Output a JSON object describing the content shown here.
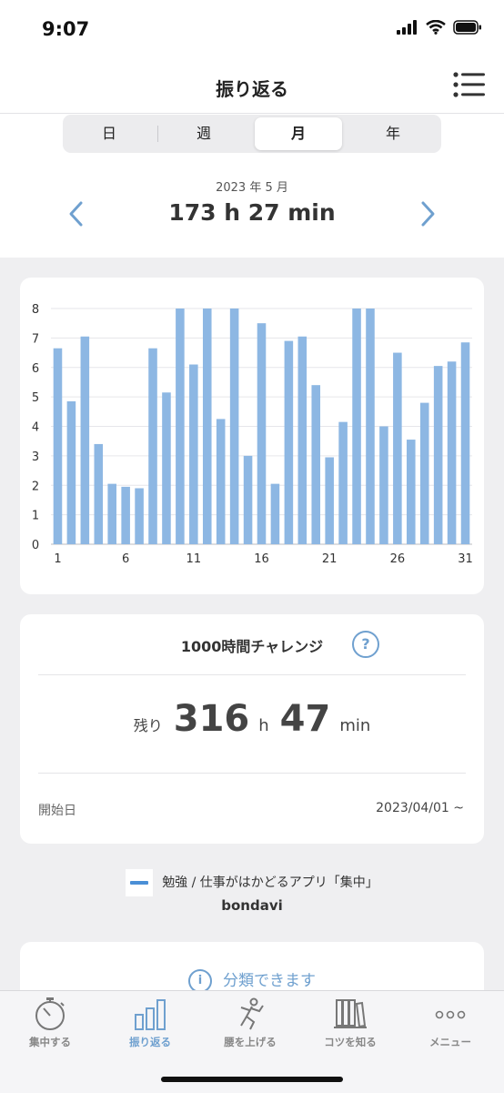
{
  "status_bar": {
    "time": "9:07"
  },
  "header": {
    "title": "振り返る"
  },
  "segments": [
    "日",
    "週",
    "月",
    "年"
  ],
  "active_segment": "月",
  "period": {
    "label": "2023 年 5 月",
    "total": "173 h 27 min"
  },
  "chart_data": {
    "type": "bar",
    "x": [
      1,
      2,
      3,
      4,
      5,
      6,
      7,
      8,
      9,
      10,
      11,
      12,
      13,
      14,
      15,
      16,
      17,
      18,
      19,
      20,
      21,
      22,
      23,
      24,
      25,
      26,
      27,
      28,
      29,
      30,
      31
    ],
    "values": [
      6.65,
      4.85,
      7.05,
      3.4,
      2.05,
      1.95,
      1.9,
      6.65,
      5.15,
      8,
      6.1,
      8,
      4.25,
      8,
      3.0,
      7.5,
      2.05,
      6.9,
      7.05,
      5.4,
      2.95,
      4.15,
      8,
      8,
      4.0,
      6.5,
      3.55,
      4.8,
      6.05,
      6.2,
      6.85
    ],
    "x_tick_labels": [
      "1",
      "6",
      "11",
      "16",
      "21",
      "26",
      "31"
    ],
    "y_tick_labels": [
      "0",
      "1",
      "2",
      "3",
      "4",
      "5",
      "6",
      "7",
      "8"
    ],
    "ylim": [
      0,
      8
    ],
    "grid": true,
    "bar_color": "#8db7e3"
  },
  "challenge": {
    "title": "1000時間チャレンジ",
    "help": "?",
    "remaining_label": "残り",
    "hours": "316",
    "hours_unit": "h",
    "minutes": "47",
    "minutes_unit": "min",
    "start_label": "開始日",
    "start_date": "2023/04/01 ~"
  },
  "promo": {
    "app_text": "勉強 / 仕事がはかどるアプリ「集中」",
    "developer": "bondavi"
  },
  "classify": {
    "info": "i",
    "label": "分類できます"
  },
  "tabs": [
    {
      "label": "集中する",
      "icon": "stopwatch-icon"
    },
    {
      "label": "振り返る",
      "icon": "bar-chart-icon"
    },
    {
      "label": "腰を上げる",
      "icon": "stretch-figure-icon"
    },
    {
      "label": "コツを知る",
      "icon": "bookshelf-icon"
    },
    {
      "label": "メニュー",
      "icon": "more-dots-icon"
    }
  ],
  "colors": {
    "accent": "#6fa0cf",
    "bar": "#8db7e3"
  }
}
